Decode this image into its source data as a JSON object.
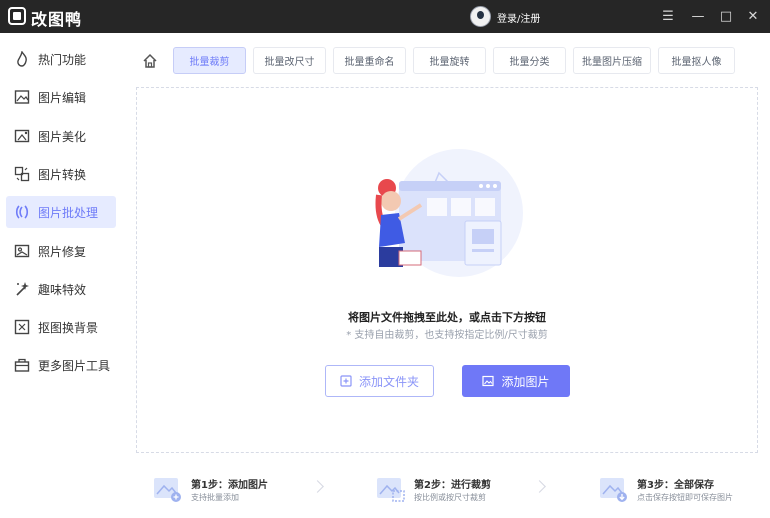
{
  "app": {
    "name": "改图鸭",
    "login_label": "登录/注册"
  },
  "window_controls": {
    "menu": "☰",
    "minimize": "—",
    "maximize": "□",
    "close": "✕"
  },
  "sidebar": {
    "items": [
      {
        "label": "热门功能",
        "icon": "fire-icon"
      },
      {
        "label": "图片编辑",
        "icon": "image-edit-icon"
      },
      {
        "label": "图片美化",
        "icon": "image-beautify-icon"
      },
      {
        "label": "图片转换",
        "icon": "image-convert-icon"
      },
      {
        "label": "图片批处理",
        "icon": "batch-process-icon",
        "active": true
      },
      {
        "label": "照片修复",
        "icon": "photo-repair-icon"
      },
      {
        "label": "趣味特效",
        "icon": "magic-wand-icon"
      },
      {
        "label": "抠图换背景",
        "icon": "cutout-icon"
      },
      {
        "label": "更多图片工具",
        "icon": "toolbox-icon"
      }
    ]
  },
  "tabs": [
    {
      "label": "批量裁剪",
      "active": true
    },
    {
      "label": "批量改尺寸"
    },
    {
      "label": "批量重命名"
    },
    {
      "label": "批量旋转"
    },
    {
      "label": "批量分类"
    },
    {
      "label": "批量图片压缩"
    },
    {
      "label": "批量抠人像"
    }
  ],
  "dropzone": {
    "title": "将图片文件拖拽至此处，或点击下方按钮",
    "subtitle": "* 支持自由裁剪，也支持按指定比例/尺寸裁剪",
    "add_folder_label": "添加文件夹",
    "add_image_label": "添加图片"
  },
  "steps": [
    {
      "title": "第1步：添加图片",
      "subtitle": "支持批量添加"
    },
    {
      "title": "第2步：进行裁剪",
      "subtitle": "按比例或按尺寸裁剪"
    },
    {
      "title": "第3步：全部保存",
      "subtitle": "点击保存按钮即可保存图片"
    }
  ],
  "colors": {
    "accent": "#6f78f7",
    "active_bg": "#e6ebff",
    "titlebar": "#262626"
  }
}
